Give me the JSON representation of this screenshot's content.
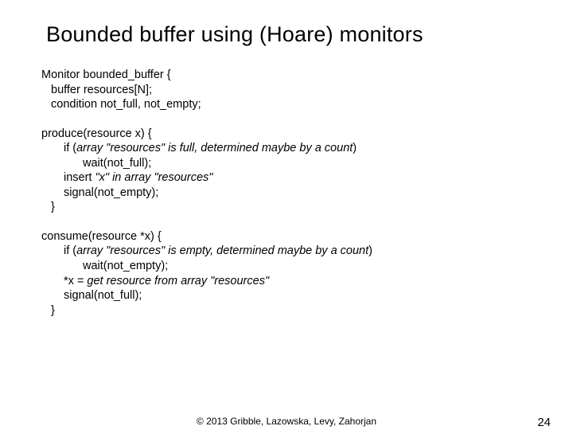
{
  "title": "Bounded buffer using (Hoare) monitors",
  "decl": {
    "l1": "Monitor bounded_buffer {",
    "l2": "buffer resources[N];",
    "l3": "condition not_full, not_empty;"
  },
  "produce": {
    "sig": "produce(resource x) {",
    "if_prefix": "if (",
    "if_cond": "array \"resources\" is full, determined maybe by a count",
    "if_suffix": ")",
    "wait": "wait(not_full);",
    "insert_prefix": "insert",
    "insert_italic": " \"x\" in array \"resources\"",
    "signal": "signal(not_empty);",
    "close": "}"
  },
  "consume": {
    "sig": "consume(resource *x) {",
    "if_prefix": "if (",
    "if_cond": "array \"resources\" is empty, determined maybe by a count",
    "if_suffix": ")",
    "wait": "wait(not_empty);",
    "get_prefix": "*x = ",
    "get_italic": "get resource from array \"resources\"",
    "signal": "signal(not_full);",
    "close": "}"
  },
  "footer": {
    "copyright": "© 2013 Gribble, Lazowska, Levy, Zahorjan",
    "pagenum": "24"
  }
}
